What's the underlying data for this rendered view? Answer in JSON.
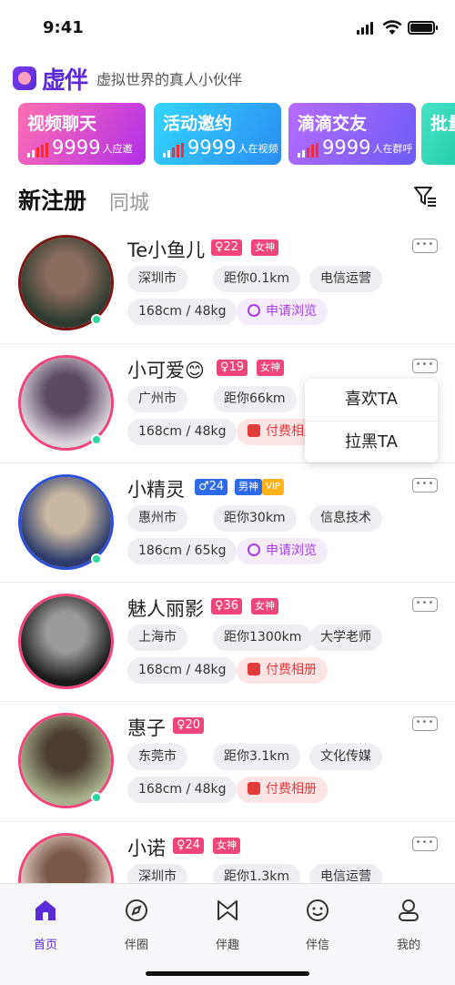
{
  "status_bar": {
    "time": "9:41"
  },
  "brand": {
    "name": "虚伴",
    "slogan": "虚拟世界的真人小伙伴"
  },
  "banners": [
    {
      "title": "视频聊天",
      "count": "9999",
      "unit": "人应邀",
      "gradient": [
        "#ff6fb1",
        "#b12fe9"
      ]
    },
    {
      "title": "活动邀约",
      "count": "9999",
      "unit": "人在视频",
      "gradient": [
        "#33d6ff",
        "#2b8cf0"
      ]
    },
    {
      "title": "滴滴交友",
      "count": "9999",
      "unit": "人在群呼",
      "gradient": [
        "#b86cff",
        "#6b5cf5"
      ]
    },
    {
      "title": "批量",
      "count": "",
      "unit": "",
      "gradient": [
        "#46e3c8",
        "#21c6a6"
      ]
    }
  ],
  "section": {
    "title": "新注册",
    "subtitle": "同城"
  },
  "users": [
    {
      "name": "Te小鱼儿",
      "gender": "♀",
      "age": "22",
      "badge": "女神",
      "vip": "",
      "city": "深圳市",
      "distance": "距你0.1km",
      "job": "电信运营",
      "body": "168cm / 48kg",
      "action": "申请浏览",
      "action_type": "apply",
      "ring_color": "#7a1616",
      "online": true
    },
    {
      "name": "小可爱😊",
      "gender": "♀",
      "age": "19",
      "badge": "女神",
      "vip": "",
      "city": "广州市",
      "distance": "距你66km",
      "job": "",
      "body": "168cm / 48kg",
      "action": "付费相册",
      "action_type": "pay",
      "ring_color": "#f0457b",
      "online": true
    },
    {
      "name": "小精灵",
      "gender": "♂",
      "age": "24",
      "badge": "男神",
      "vip": "VIP",
      "city": "惠州市",
      "distance": "距你30km",
      "job": "信息技术",
      "body": "186cm / 65kg",
      "action": "申请浏览",
      "action_type": "apply",
      "ring_color": "#2f4fd6",
      "online": true
    },
    {
      "name": "魅人丽影",
      "gender": "♀",
      "age": "36",
      "badge": "女神",
      "vip": "",
      "city": "上海市",
      "distance": "距你1300km",
      "job": "大学老师",
      "body": "168cm / 48kg",
      "action": "付费相册",
      "action_type": "pay",
      "ring_color": "#f0457b",
      "online": false
    },
    {
      "name": "惠子",
      "gender": "♀",
      "age": "20",
      "badge": "",
      "vip": "",
      "city": "东莞市",
      "distance": "距你3.1km",
      "job": "文化传媒",
      "body": "168cm / 48kg",
      "action": "付费相册",
      "action_type": "pay",
      "ring_color": "#f0457b",
      "online": true
    },
    {
      "name": "小诺",
      "gender": "♀",
      "age": "24",
      "badge": "女神",
      "vip": "",
      "city": "深圳市",
      "distance": "距你1.3km",
      "job": "电信运营",
      "body": "",
      "action": "",
      "action_type": "",
      "ring_color": "#f0457b",
      "online": false
    }
  ],
  "popup_menu": {
    "like": "喜欢TA",
    "block": "拉黑TA"
  },
  "tabs": [
    {
      "label": "首页",
      "icon": "home-icon",
      "active": true
    },
    {
      "label": "伴圈",
      "icon": "compass-icon",
      "active": false
    },
    {
      "label": "伴趣",
      "icon": "bow-icon",
      "active": false
    },
    {
      "label": "伴信",
      "icon": "chat-icon",
      "active": false
    },
    {
      "label": "我的",
      "icon": "profile-icon",
      "active": false
    }
  ],
  "colors": {
    "accent": "#5a2bd6",
    "female_tag": "#f0457b",
    "male_tag": "#2f6ae6",
    "online": "#2dd7a0"
  }
}
